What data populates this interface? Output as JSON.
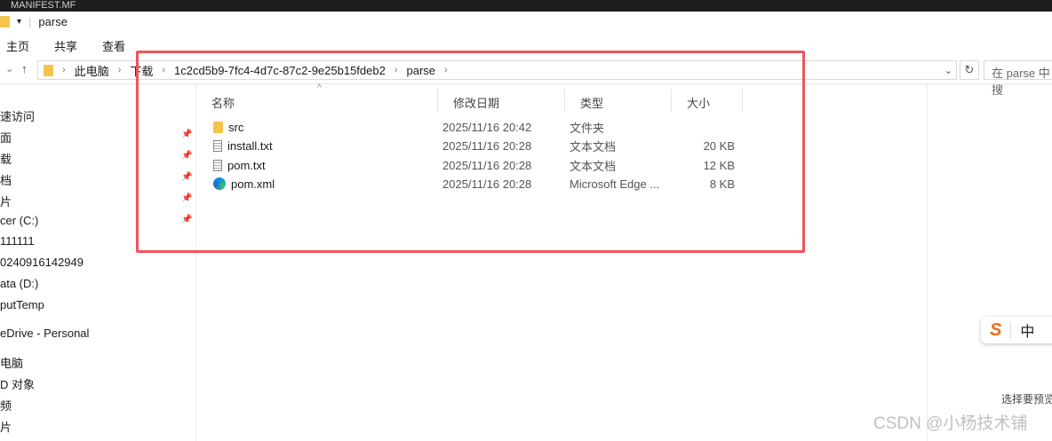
{
  "top_strip": {
    "text": "MANIFEST.MF"
  },
  "window": {
    "title": "parse"
  },
  "ribbon": {
    "tabs": [
      "主页",
      "共享",
      "查看"
    ]
  },
  "address": {
    "crumbs": [
      "此电脑",
      "下载",
      "1c2cd5b9-7fc4-4d7c-87c2-9e25b15fdeb2",
      "parse"
    ],
    "search_placeholder": "在 parse 中搜"
  },
  "sidebar": {
    "items": [
      "速访问",
      "面",
      "载",
      "档",
      "片",
      "cer (C:)",
      "111111",
      "0240916142949",
      "ata (D:)",
      "putTemp",
      "eDrive - Personal",
      "电脑",
      "D 对象",
      "频",
      "片"
    ]
  },
  "columns": [
    "名称",
    "修改日期",
    "类型",
    "大小"
  ],
  "files": [
    {
      "name": "src",
      "date": "2025/11/16 20:42",
      "type": "文件夹",
      "size": "",
      "icon": "folder-icon"
    },
    {
      "name": "install.txt",
      "date": "2025/11/16 20:28",
      "type": "文本文档",
      "size": "20 KB",
      "icon": "text-file-icon"
    },
    {
      "name": "pom.txt",
      "date": "2025/11/16 20:28",
      "type": "文本文档",
      "size": "12 KB",
      "icon": "text-file-icon"
    },
    {
      "name": "pom.xml",
      "date": "2025/11/16 20:28",
      "type": "Microsoft Edge ...",
      "size": "8 KB",
      "icon": "edge-icon"
    }
  ],
  "preview": {
    "text": "选择要预览"
  },
  "ime": {
    "mode": "中"
  },
  "watermark": "CSDN @小杨技术铺",
  "colors": {
    "highlight_box": "#f0545c"
  }
}
